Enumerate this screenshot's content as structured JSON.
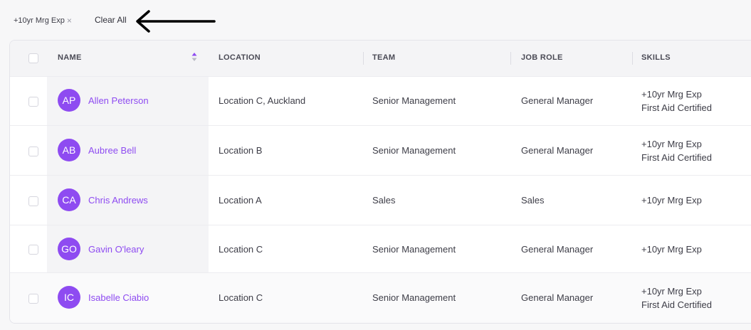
{
  "filters": {
    "chip_label": "+10yr Mrg Exp",
    "chip_close": "×",
    "clear_all_label": "Clear All"
  },
  "table": {
    "columns": [
      "NAME",
      "LOCATION",
      "TEAM",
      "JOB ROLE",
      "SKILLS"
    ],
    "rows": [
      {
        "initials": "AP",
        "name": "Allen Peterson",
        "location": "Location C, Auckland",
        "team": "Senior Management",
        "role": "General Manager",
        "skills": [
          "+10yr Mrg Exp",
          "First Aid Certified"
        ]
      },
      {
        "initials": "AB",
        "name": "Aubree Bell",
        "location": "Location B",
        "team": "Senior Management",
        "role": "General Manager",
        "skills": [
          "+10yr Mrg Exp",
          "First Aid Certified"
        ]
      },
      {
        "initials": "CA",
        "name": "Chris Andrews",
        "location": "Location A",
        "team": "Sales",
        "role": "Sales",
        "skills": [
          "+10yr Mrg Exp"
        ]
      },
      {
        "initials": "GO",
        "name": "Gavin O'leary",
        "location": "Location C",
        "team": "Senior Management",
        "role": "General Manager",
        "skills": [
          "+10yr Mrg Exp"
        ]
      },
      {
        "initials": "IC",
        "name": "Isabelle Ciabio",
        "location": "Location C",
        "team": "Senior Management",
        "role": "General Manager",
        "skills": [
          "+10yr Mrg Exp",
          "First Aid Certified"
        ]
      }
    ]
  },
  "colors": {
    "accent": "#8e4bf1",
    "header_bg": "#f4f4f6",
    "border": "#e4e4ea"
  }
}
